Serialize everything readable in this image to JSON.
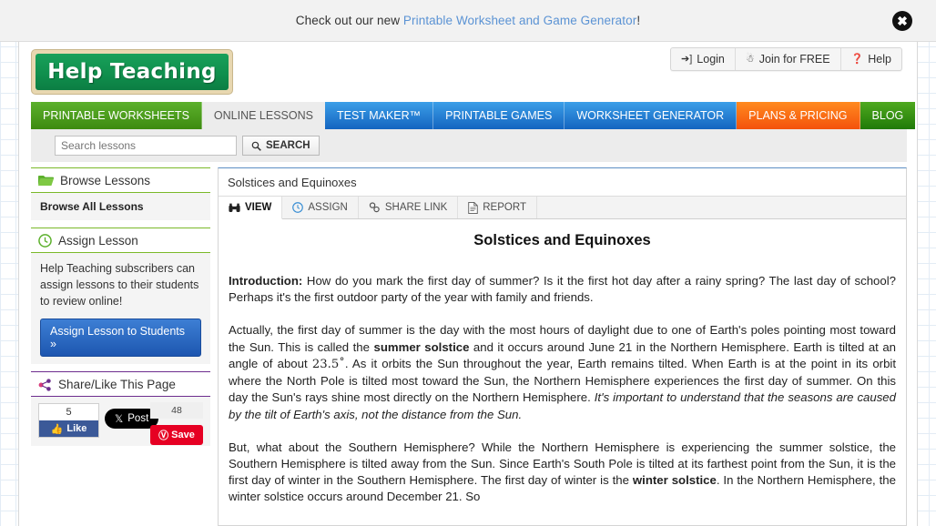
{
  "promo": {
    "prefix": "Check out our new ",
    "link": "Printable Worksheet and Game Generator",
    "suffix": "!",
    "close_icon": "close-icon"
  },
  "header": {
    "logo_text": "Help Teaching",
    "account": [
      {
        "label": "Login",
        "icon": "login-icon"
      },
      {
        "label": "Join for FREE",
        "icon": "person-icon"
      },
      {
        "label": "Help",
        "icon": "question-circle-icon"
      }
    ]
  },
  "nav": [
    {
      "label": "PRINTABLE WORKSHEETS",
      "style": "nav-green"
    },
    {
      "label": "ONLINE LESSONS",
      "style": "nav-active"
    },
    {
      "label": "TEST MAKER™",
      "style": "nav-blue"
    },
    {
      "label": "PRINTABLE GAMES",
      "style": "nav-blue"
    },
    {
      "label": "WORKSHEET GENERATOR",
      "style": "nav-blue"
    },
    {
      "label": "PLANS & PRICING",
      "style": "nav-orange"
    },
    {
      "label": "BLOG",
      "style": "nav-blog"
    }
  ],
  "search": {
    "placeholder": "Search lessons",
    "value": "",
    "button_label": "SEARCH",
    "icon": "search-icon"
  },
  "sidebar": {
    "browse": {
      "title": "Browse Lessons",
      "icon": "folder-icon",
      "all_lessons": "Browse All Lessons"
    },
    "assign": {
      "title": "Assign Lesson",
      "icon": "clock-icon",
      "text": "Help Teaching subscribers can assign lessons to their students to review online!",
      "button_label": "Assign Lesson to Students »"
    },
    "share": {
      "title": "Share/Like This Page",
      "icon": "share-icon",
      "facebook_count": "5",
      "facebook_label": "Like",
      "x_label": "Post",
      "pinterest_count": "48",
      "pinterest_label": "Save"
    }
  },
  "lesson": {
    "breadcrumb": "Solstices and Equinoxes",
    "tabs": [
      {
        "label": "VIEW",
        "icon": "binoculars-icon",
        "active": true
      },
      {
        "label": "ASSIGN",
        "icon": "clock-icon",
        "active": false
      },
      {
        "label": "SHARE LINK",
        "icon": "link-icon",
        "active": false
      },
      {
        "label": "REPORT",
        "icon": "document-icon",
        "active": false
      }
    ],
    "title": "Solstices and Equinoxes",
    "paragraphs": [
      {
        "id": "p-intro",
        "parts": [
          {
            "t": "b",
            "s": "Introduction:"
          },
          {
            "t": "n",
            "s": " How do you mark the first day of summer? Is it the first hot day after a rainy spring? The last day of school? Perhaps it's the first outdoor party of the year with family and friends."
          }
        ]
      },
      {
        "id": "p-solstice",
        "parts": [
          {
            "t": "n",
            "s": "Actually, the first day of summer is the day with the most hours of daylight due to one of Earth's poles pointing most toward the Sun. This is called the "
          },
          {
            "t": "b",
            "s": "summer solstice"
          },
          {
            "t": "n",
            "s": " and it occurs around June 21 in the Northern Hemisphere. Earth is tilted at an angle of about "
          },
          {
            "t": "d",
            "s": "23.5˚"
          },
          {
            "t": "n",
            "s": ". As it orbits the Sun throughout the year, Earth remains tilted. When Earth is at the point in its orbit where the North Pole is tilted most toward the Sun, the Northern Hemisphere experiences the first day of summer. On this day the Sun's rays shine most directly on the Northern Hemisphere. "
          },
          {
            "t": "i",
            "s": "It's important to understand that the seasons are caused by the tilt of Earth's axis, not the distance from the Sun."
          }
        ]
      },
      {
        "id": "p-southern",
        "parts": [
          {
            "t": "n",
            "s": "But, what about the Southern Hemisphere? While the Northern Hemisphere is experiencing the summer solstice, the Southern Hemisphere is tilted away from the Sun. Since Earth's South Pole is tilted at its farthest point from the Sun, it is the first day of winter in the Southern Hemisphere. The first day of winter is the "
          },
          {
            "t": "b",
            "s": "winter solstice"
          },
          {
            "t": "n",
            "s": ". In the Northern Hemisphere, the winter solstice occurs around December 21. So"
          }
        ]
      }
    ]
  }
}
